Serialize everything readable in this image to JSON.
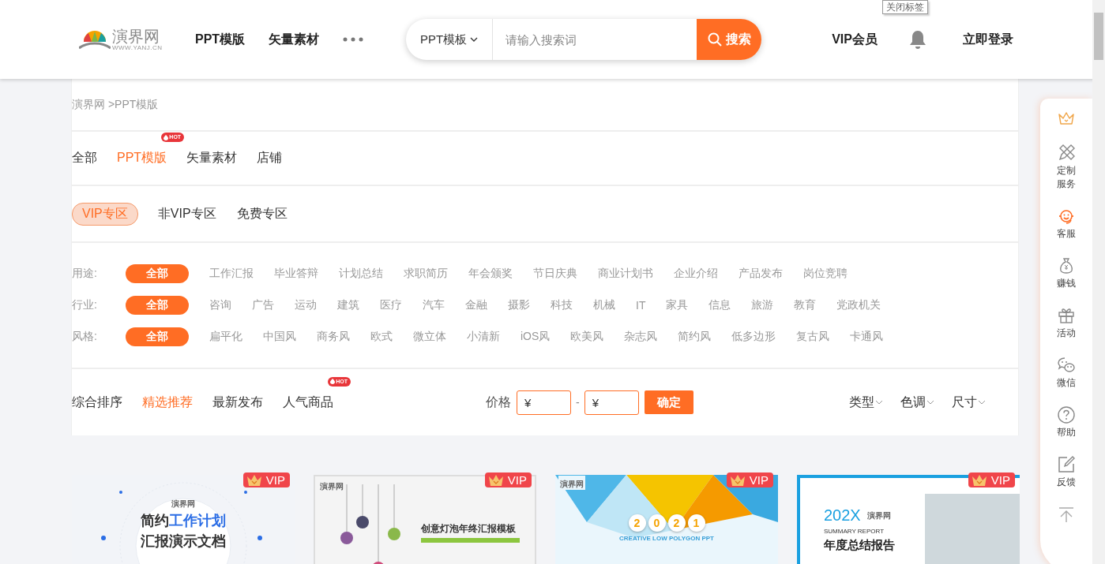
{
  "header": {
    "logo": {
      "name": "演界网",
      "domain": "WWW.YANJ.CN"
    },
    "nav": [
      {
        "label": "PPT模版"
      },
      {
        "label": "矢量素材"
      }
    ],
    "search": {
      "category": "PPT模板",
      "placeholder": "请输入搜索词",
      "button": "搜索"
    },
    "vip": "VIP会员",
    "login": "立即登录"
  },
  "tooltip": "关闭标签",
  "breadcrumb": "演界网 >PPT模版",
  "tabs": [
    {
      "label": "全部",
      "selected": false
    },
    {
      "label": "PPT模版",
      "selected": true,
      "badge": "HOT"
    },
    {
      "label": "矢量素材",
      "selected": false
    },
    {
      "label": "店铺",
      "selected": false
    }
  ],
  "zones": [
    {
      "label": "VIP专区",
      "selected": true
    },
    {
      "label": "非VIP专区",
      "selected": false
    },
    {
      "label": "免费专区",
      "selected": false
    }
  ],
  "filters": [
    {
      "label": "用途:",
      "items": [
        {
          "label": "全部",
          "selected": true
        },
        {
          "label": "工作汇报",
          "selected": false
        },
        {
          "label": "毕业答辩",
          "selected": false
        },
        {
          "label": "计划总结",
          "selected": false
        },
        {
          "label": "求职简历",
          "selected": false
        },
        {
          "label": "年会颁奖",
          "selected": false
        },
        {
          "label": "节日庆典",
          "selected": false
        },
        {
          "label": "商业计划书",
          "selected": false
        },
        {
          "label": "企业介绍",
          "selected": false
        },
        {
          "label": "产品发布",
          "selected": false
        },
        {
          "label": "岗位竞聘",
          "selected": false
        }
      ]
    },
    {
      "label": "行业:",
      "items": [
        {
          "label": "全部",
          "selected": true
        },
        {
          "label": "咨询",
          "selected": false
        },
        {
          "label": "广告",
          "selected": false
        },
        {
          "label": "运动",
          "selected": false
        },
        {
          "label": "建筑",
          "selected": false
        },
        {
          "label": "医疗",
          "selected": false
        },
        {
          "label": "汽车",
          "selected": false
        },
        {
          "label": "金融",
          "selected": false
        },
        {
          "label": "摄影",
          "selected": false
        },
        {
          "label": "科技",
          "selected": false
        },
        {
          "label": "机械",
          "selected": false
        },
        {
          "label": "IT",
          "selected": false
        },
        {
          "label": "家具",
          "selected": false
        },
        {
          "label": "信息",
          "selected": false
        },
        {
          "label": "旅游",
          "selected": false
        },
        {
          "label": "教育",
          "selected": false
        },
        {
          "label": "党政机关",
          "selected": false
        }
      ]
    },
    {
      "label": "风格:",
      "items": [
        {
          "label": "全部",
          "selected": true
        },
        {
          "label": "扁平化",
          "selected": false
        },
        {
          "label": "中国风",
          "selected": false
        },
        {
          "label": "商务风",
          "selected": false
        },
        {
          "label": "欧式",
          "selected": false
        },
        {
          "label": "微立体",
          "selected": false
        },
        {
          "label": "小清新",
          "selected": false
        },
        {
          "label": "iOS风",
          "selected": false
        },
        {
          "label": "欧美风",
          "selected": false
        },
        {
          "label": "杂志风",
          "selected": false
        },
        {
          "label": "简约风",
          "selected": false
        },
        {
          "label": "低多边形",
          "selected": false
        },
        {
          "label": "复古风",
          "selected": false
        },
        {
          "label": "卡通风",
          "selected": false
        }
      ]
    }
  ],
  "sort": [
    {
      "label": "综合排序",
      "selected": false
    },
    {
      "label": "精选推荐",
      "selected": true
    },
    {
      "label": "最新发布",
      "selected": false
    },
    {
      "label": "人气商品",
      "selected": false,
      "badge": "HOT"
    }
  ],
  "price": {
    "label": "价格",
    "min_placeholder": "¥",
    "separator": "-",
    "max_placeholder": "¥",
    "button": "确定"
  },
  "dropdowns": [
    {
      "label": "类型"
    },
    {
      "label": "色调"
    },
    {
      "label": "尺寸"
    }
  ],
  "cards": [
    {
      "kind": "plan",
      "badge": "VIP",
      "logo": "演界网",
      "title_parts": [
        {
          "text": "简约",
          "accent": false
        },
        {
          "text": "工作计划",
          "accent": true
        }
      ],
      "subtitle": "汇报演示文档"
    },
    {
      "kind": "bulb",
      "badge": "VIP",
      "logo": "演界网",
      "title": "创意灯泡年终汇报模板"
    },
    {
      "kind": "polygon",
      "badge": "VIP",
      "logo": "演界网",
      "year_digits": [
        "2",
        "0",
        "2",
        "1"
      ],
      "caption": "CREATIVE LOW POLYGON PPT"
    },
    {
      "kind": "report",
      "badge": "VIP",
      "logo": "演界网",
      "year": "202X",
      "caption": "SUMMARY REPORT",
      "title": "年度总结报告"
    }
  ],
  "side_menu": [
    {
      "kind": "crown"
    },
    {
      "kind": "tools",
      "label": "定制服务"
    },
    {
      "kind": "headset",
      "label": "客服"
    },
    {
      "kind": "moneybag",
      "label": "赚钱"
    },
    {
      "kind": "gift",
      "label": "活动"
    },
    {
      "kind": "wechat",
      "label": "微信"
    },
    {
      "kind": "help",
      "label": "帮助"
    },
    {
      "kind": "feedback",
      "label": "反馈"
    },
    {
      "kind": "top"
    }
  ]
}
